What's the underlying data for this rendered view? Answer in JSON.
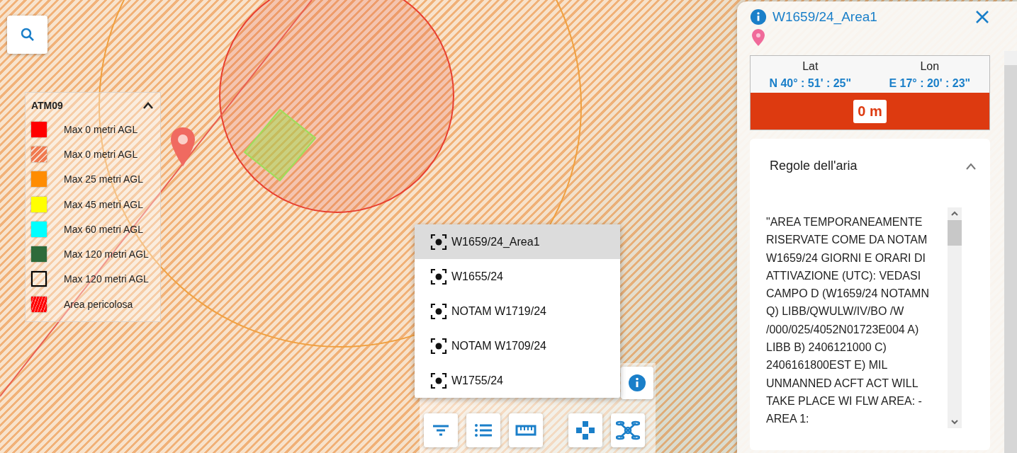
{
  "legend": {
    "title": "ATM09",
    "expanded": true,
    "items": [
      {
        "label": "Max 0 metri AGL",
        "kind": "solid",
        "color": "#ff0000"
      },
      {
        "label": "Max 0 metri AGL",
        "kind": "hatched",
        "color": "#f07a50"
      },
      {
        "label": "Max 25 metri AGL",
        "kind": "solid",
        "color": "#ff8c00"
      },
      {
        "label": "Max 45 metri AGL",
        "kind": "solid",
        "color": "#ffff00"
      },
      {
        "label": "Max 60 metri AGL",
        "kind": "solid",
        "color": "#00ffff"
      },
      {
        "label": "Max 120 metri AGL",
        "kind": "solid",
        "color": "#2e6b3a"
      },
      {
        "label": "Max 120 metri AGL",
        "kind": "outline",
        "color": "#000000"
      },
      {
        "label": "Area pericolosa",
        "kind": "danger",
        "color": "#ff0000"
      }
    ]
  },
  "area_list": {
    "options": [
      {
        "label": "W1659/24_Area1",
        "selected": true
      },
      {
        "label": "W1655/24",
        "selected": false
      },
      {
        "label": "NOTAM W1719/24",
        "selected": false
      },
      {
        "label": "NOTAM W1709/24",
        "selected": false
      },
      {
        "label": "W1755/24",
        "selected": false
      }
    ]
  },
  "panel": {
    "title": "W1659/24_Area1",
    "lat_label": "Lat",
    "lat": "N 40° : 51' : 25\"",
    "lon_label": "Lon",
    "lon": "E 17° : 20' : 23\"",
    "altitude": "0 m",
    "section": {
      "title": "Regole dell'aria",
      "expanded": true,
      "text": "\"AREA TEMPORANEAMENTE RISERVATE COME DA NOTAM W1659/24 GIORNI E ORARI DI ATTIVAZIONE (UTC): VEDASI CAMPO D (W1659/24 NOTAMN Q) LIBB/QWULW/IV/BO /W /000/025/4052N01723E004 A) LIBB B) 2406121000 C) 2406161800EST E) MIL UNMANNED ACFT ACT WILL TAKE PLACE WI FLW AREA: - AREA 1:"
    }
  }
}
